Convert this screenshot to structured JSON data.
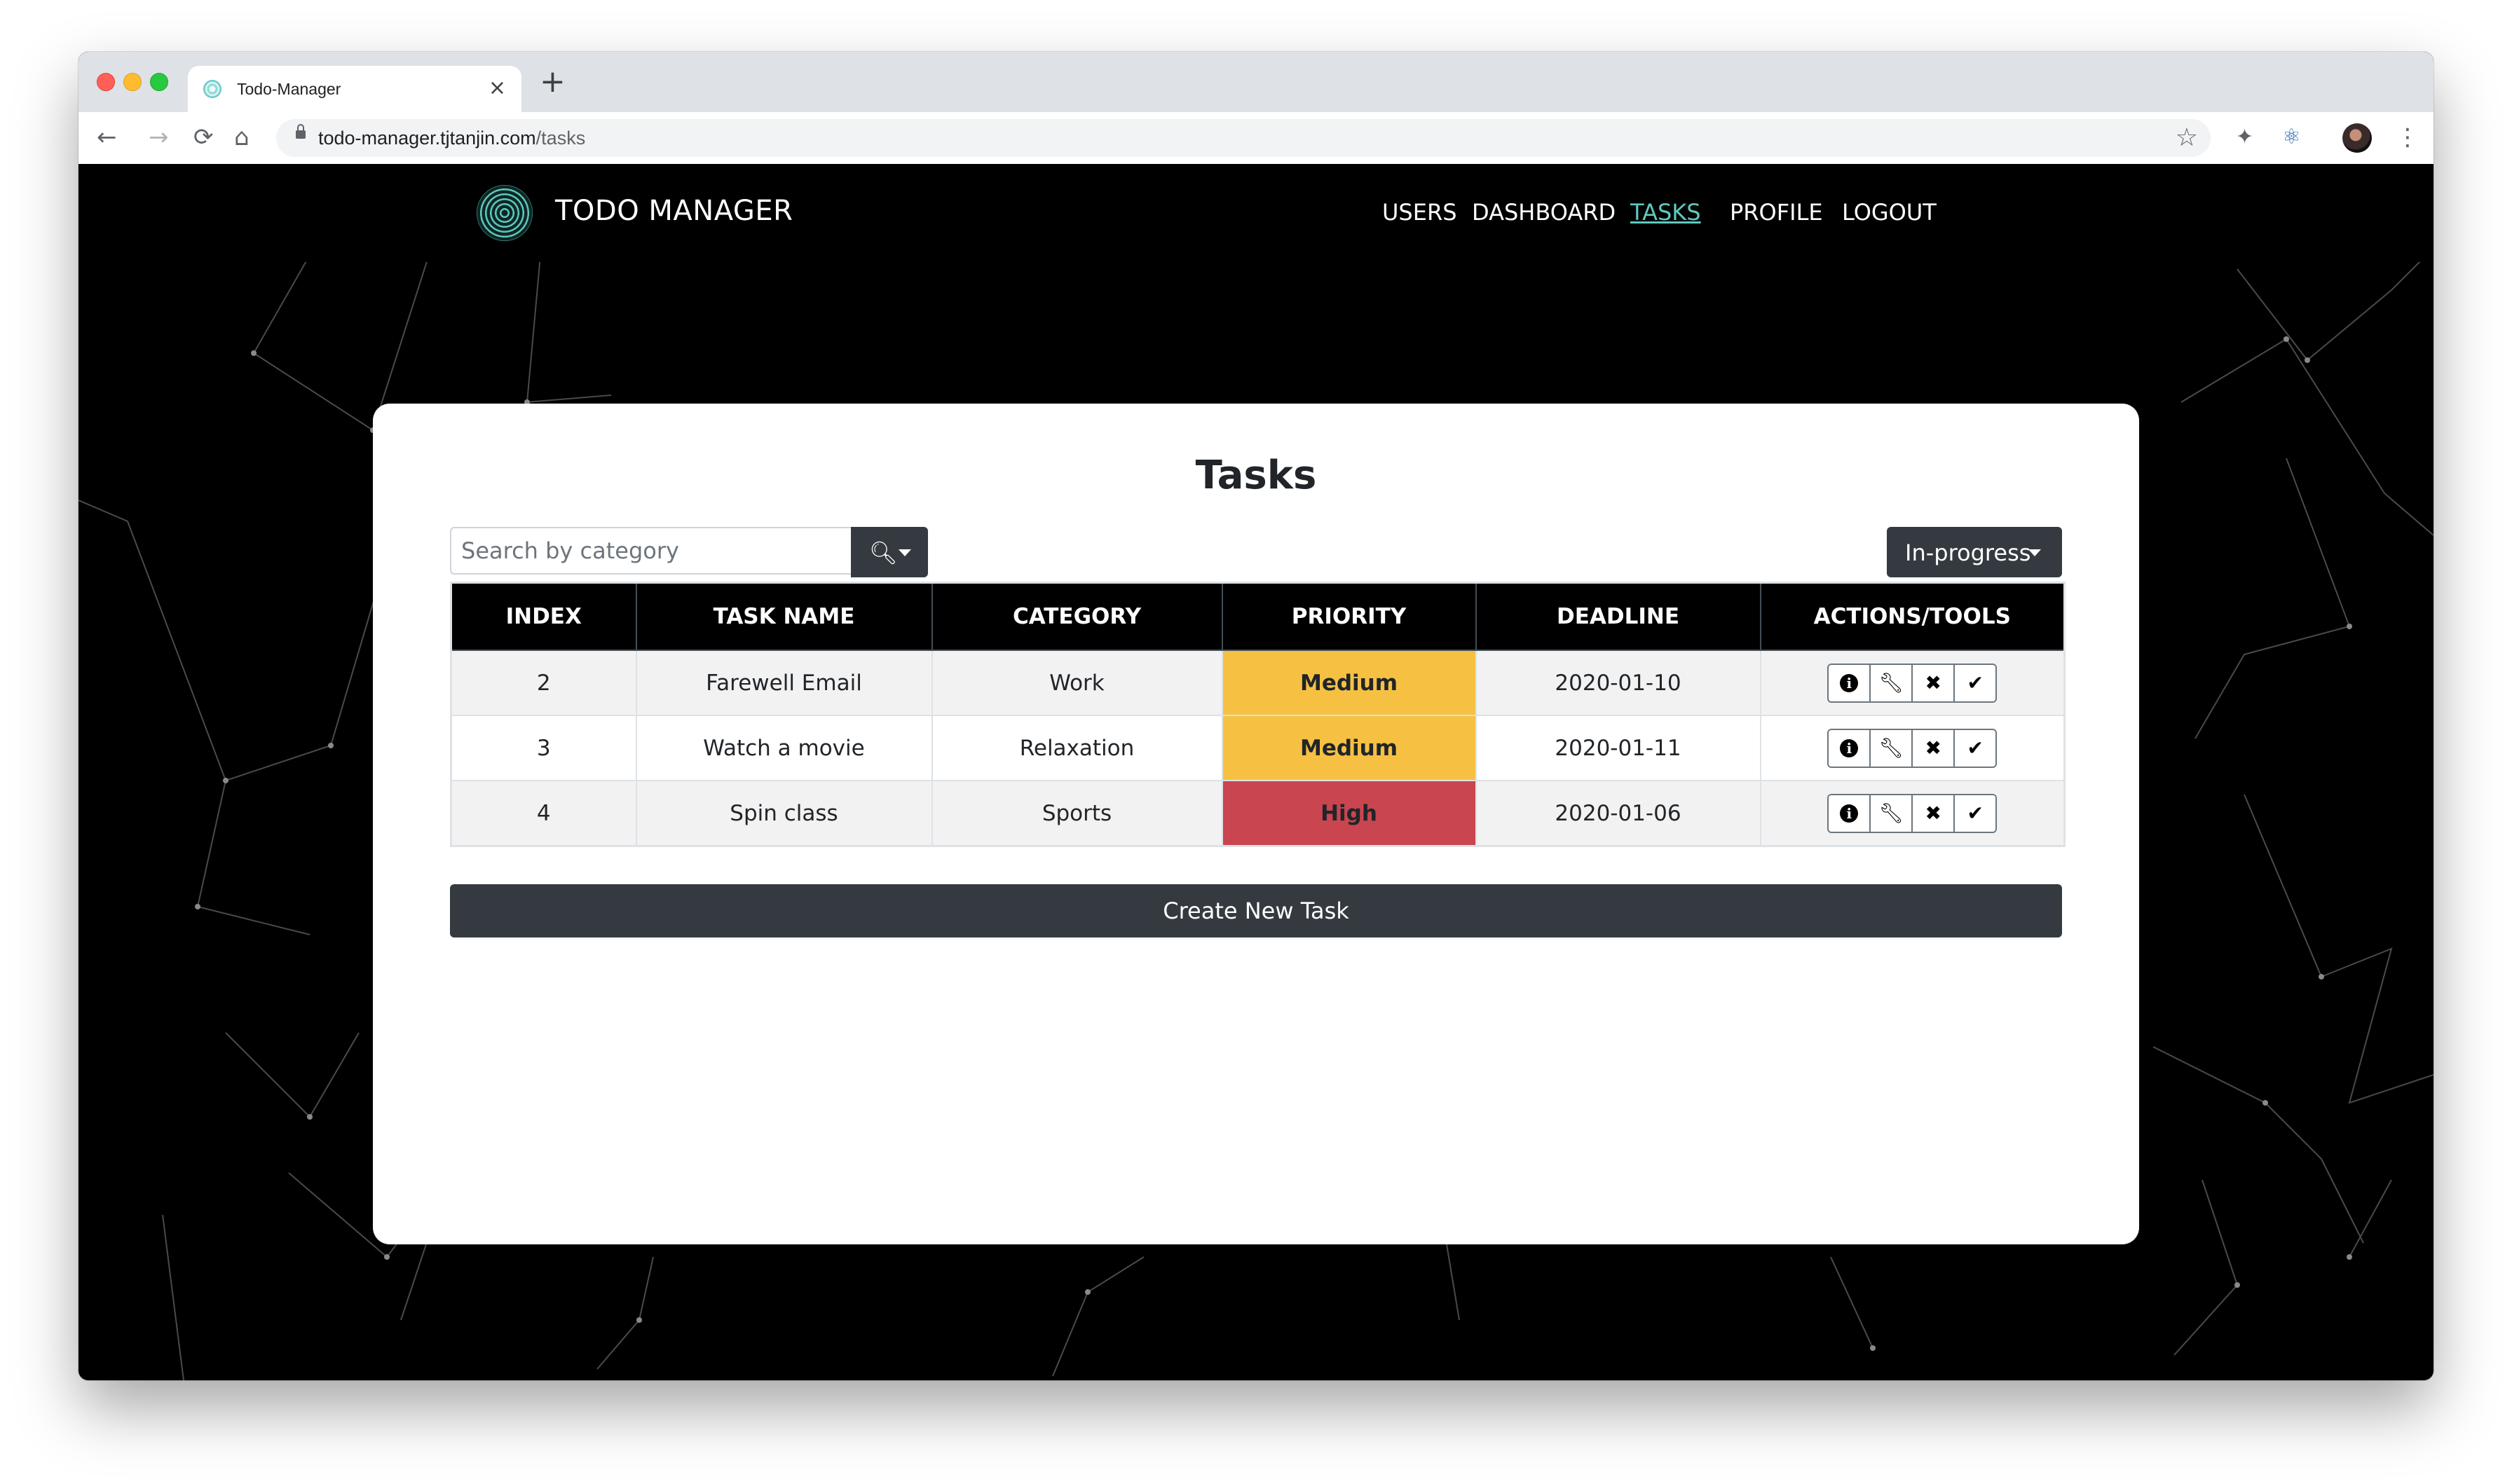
{
  "browser": {
    "tab_title": "Todo-Manager",
    "tab_close": "×",
    "new_tab": "+",
    "url_host": "todo-manager.tjtanjin.com",
    "url_path": "/tasks"
  },
  "navbar": {
    "brand": "TODO MANAGER",
    "links": [
      {
        "label": "USERS",
        "active": false
      },
      {
        "label": "DASHBOARD",
        "active": false
      },
      {
        "label": "TASKS",
        "active": true
      },
      {
        "label": "PROFILE",
        "active": false
      },
      {
        "label": "LOGOUT",
        "active": false
      }
    ]
  },
  "main": {
    "title": "Tasks",
    "search": {
      "placeholder": "Search by category",
      "value": ""
    },
    "filter": {
      "selected": "In-progress"
    },
    "table": {
      "headers": [
        "INDEX",
        "TASK NAME",
        "CATEGORY",
        "PRIORITY",
        "DEADLINE",
        "ACTIONS/TOOLS"
      ],
      "rows": [
        {
          "index": "2",
          "name": "Farewell Email",
          "category": "Work",
          "priority": "Medium",
          "deadline": "2020-01-10"
        },
        {
          "index": "3",
          "name": "Watch a movie",
          "category": "Relaxation",
          "priority": "Medium",
          "deadline": "2020-01-11"
        },
        {
          "index": "4",
          "name": "Spin class",
          "category": "Sports",
          "priority": "High",
          "deadline": "2020-01-06"
        }
      ],
      "actions": [
        "info-icon",
        "wrench-icon",
        "times-icon",
        "check-icon"
      ]
    },
    "create_button": "Create New Task"
  },
  "colors": {
    "accent": "#5ec9bd",
    "priority_medium": "#f6c142",
    "priority_high": "#c9454f",
    "dark_button": "#343a40"
  }
}
